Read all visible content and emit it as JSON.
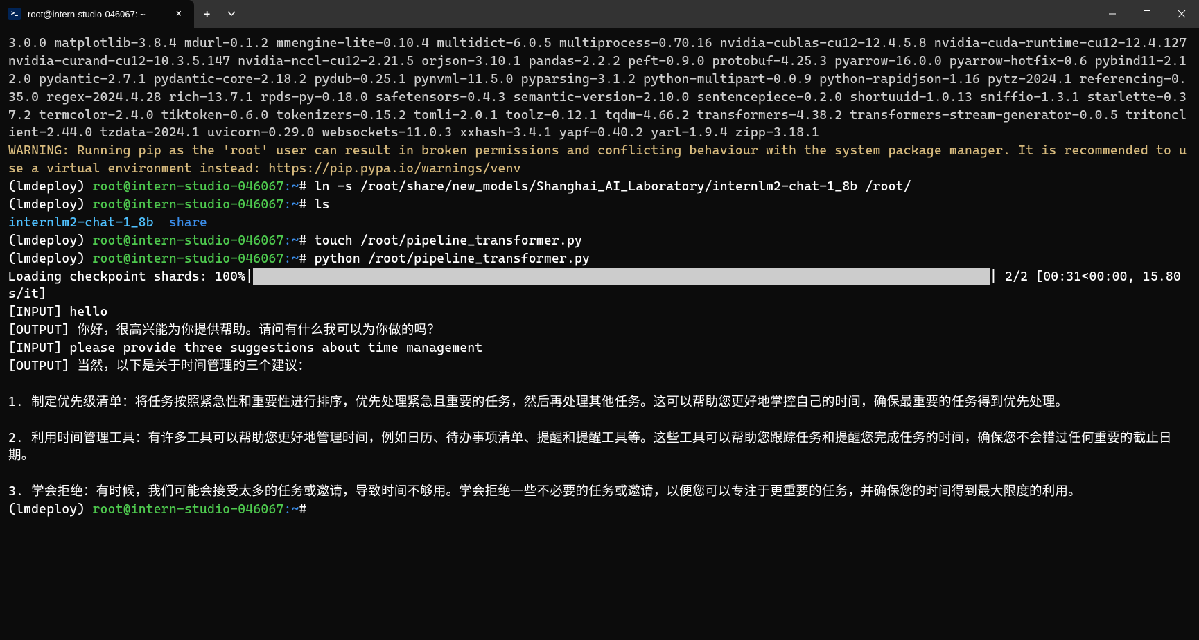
{
  "titlebar": {
    "tab_title": "root@intern-studio-046067: ~",
    "close_glyph": "×",
    "new_tab_glyph": "+"
  },
  "terminal": {
    "packages": "3.0.0 matplotlib-3.8.4 mdurl-0.1.2 mmengine-lite-0.10.4 multidict-6.0.5 multiprocess-0.70.16 nvidia-cublas-cu12-12.4.5.8 nvidia-cuda-runtime-cu12-12.4.127 nvidia-curand-cu12-10.3.5.147 nvidia-nccl-cu12-2.21.5 orjson-3.10.1 pandas-2.2.2 peft-0.9.0 protobuf-4.25.3 pyarrow-16.0.0 pyarrow-hotfix-0.6 pybind11-2.12.0 pydantic-2.7.1 pydantic-core-2.18.2 pydub-0.25.1 pynvml-11.5.0 pyparsing-3.1.2 python-multipart-0.0.9 python-rapidjson-1.16 pytz-2024.1 referencing-0.35.0 regex-2024.4.28 rich-13.7.1 rpds-py-0.18.0 safetensors-0.4.3 semantic-version-2.10.0 sentencepiece-0.2.0 shortuuid-1.0.13 sniffio-1.3.1 starlette-0.37.2 termcolor-2.4.0 tiktoken-0.6.0 tokenizers-0.15.2 tomli-2.0.1 toolz-0.12.1 tqdm-4.66.2 transformers-4.38.2 transformers-stream-generator-0.0.5 tritonclient-2.44.0 tzdata-2024.1 uvicorn-0.29.0 websockets-11.0.3 xxhash-3.4.1 yapf-0.40.2 yarl-1.9.4 zipp-3.18.1",
    "warning": "WARNING: Running pip as the 'root' user can result in broken permissions and conflicting behaviour with the system package manager. It is recommended to use a virtual environment instead: https://pip.pypa.io/warnings/venv",
    "env": "(lmdeploy) ",
    "userhost": "root@intern-studio-046067",
    "path": ":~",
    "prompt_char": "# ",
    "cmd1": "ln -s /root/share/new_models/Shanghai_AI_Laboratory/internlm2-chat-1_8b /root/",
    "cmd2": "ls",
    "ls_out1": "internlm2-chat-1_8b",
    "ls_out2": "  share",
    "cmd3": "touch /root/pipeline_transformer.py",
    "cmd4": "python /root/pipeline_transformer.py",
    "loading_label": "Loading checkpoint shards: 100%|",
    "loading_stats": "| 2/2 [00:31<00:00, 15.80s/it]",
    "input1": "[INPUT] hello",
    "output1": "[OUTPUT] 你好，很高兴能为你提供帮助。请问有什么我可以为你做的吗？",
    "input2": "[INPUT] please provide three suggestions about time management",
    "output2_head": "[OUTPUT] 当然，以下是关于时间管理的三个建议：",
    "suggestion1": "1. 制定优先级清单：将任务按照紧急性和重要性进行排序，优先处理紧急且重要的任务，然后再处理其他任务。这可以帮助您更好地掌控自己的时间，确保最重要的任务得到优先处理。",
    "suggestion2": "2. 利用时间管理工具：有许多工具可以帮助您更好地管理时间，例如日历、待办事项清单、提醒和提醒工具等。这些工具可以帮助您跟踪任务和提醒您完成任务的时间，确保您不会错过任何重要的截止日期。",
    "suggestion3": "3. 学会拒绝：有时候，我们可能会接受太多的任务或邀请，导致时间不够用。学会拒绝一些不必要的任务或邀请，以便您可以专注于更重要的任务，并确保您的时间得到最大限度的利用。"
  }
}
